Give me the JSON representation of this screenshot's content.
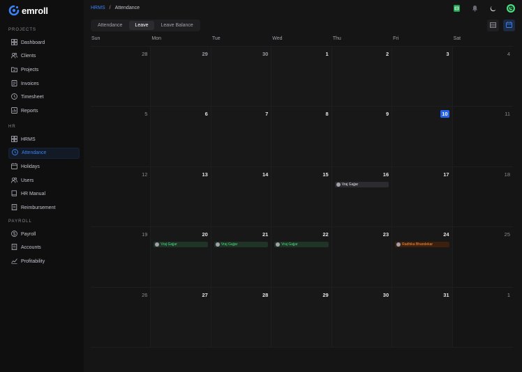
{
  "app": {
    "name": "emroll"
  },
  "colors": {
    "accent": "#3b82f6",
    "today": "#2563eb"
  },
  "sidebar": {
    "sections": [
      {
        "title": "PROJECTS",
        "items": [
          {
            "label": "Dashboard",
            "icon": "dashboard-icon"
          },
          {
            "label": "Clients",
            "icon": "users-icon"
          },
          {
            "label": "Projects",
            "icon": "folder-icon"
          },
          {
            "label": "Invoices",
            "icon": "invoice-icon"
          },
          {
            "label": "Timesheet",
            "icon": "clock-icon"
          },
          {
            "label": "Reports",
            "icon": "reports-icon"
          }
        ]
      },
      {
        "title": "HR",
        "items": [
          {
            "label": "HRMS",
            "icon": "dashboard-icon"
          },
          {
            "label": "Attendance",
            "icon": "clock-icon",
            "active": true
          },
          {
            "label": "Holidays",
            "icon": "calendar-icon"
          },
          {
            "label": "Users",
            "icon": "users-icon"
          },
          {
            "label": "HR Manual",
            "icon": "book-icon"
          },
          {
            "label": "Reimbursement",
            "icon": "receipt-icon"
          }
        ]
      },
      {
        "title": "PAYROLL",
        "items": [
          {
            "label": "Payroll",
            "icon": "coin-icon"
          },
          {
            "label": "Accounts",
            "icon": "receipt-icon"
          },
          {
            "label": "Profitability",
            "icon": "chart-icon"
          }
        ]
      }
    ]
  },
  "breadcrumb": {
    "parent": "HRMS",
    "separator": "/",
    "current": "Attendance"
  },
  "tabs": [
    {
      "label": "Attendance",
      "active": false
    },
    {
      "label": "Leave",
      "active": true
    },
    {
      "label": "Leave Balance",
      "active": false
    }
  ],
  "calendar": {
    "weekdays": [
      "Sun",
      "Mon",
      "Tue",
      "Wed",
      "Thu",
      "Fri",
      "Sat"
    ],
    "days": [
      {
        "n": "28",
        "muted": true
      },
      {
        "n": "29",
        "muted": true
      },
      {
        "n": "30",
        "muted": true
      },
      {
        "n": "1"
      },
      {
        "n": "2"
      },
      {
        "n": "3"
      },
      {
        "n": "4"
      },
      {
        "n": "5"
      },
      {
        "n": "6"
      },
      {
        "n": "7"
      },
      {
        "n": "8"
      },
      {
        "n": "9"
      },
      {
        "n": "10",
        "today": true
      },
      {
        "n": "11"
      },
      {
        "n": "12"
      },
      {
        "n": "13"
      },
      {
        "n": "14"
      },
      {
        "n": "15"
      },
      {
        "n": "16",
        "event": {
          "name": "Vraj Gajjar",
          "color": "grey"
        }
      },
      {
        "n": "17"
      },
      {
        "n": "18"
      },
      {
        "n": "19"
      },
      {
        "n": "20",
        "event": {
          "name": "Vraj Gajjar",
          "color": "green"
        }
      },
      {
        "n": "21",
        "event": {
          "name": "Vraj Gajjar",
          "color": "green"
        }
      },
      {
        "n": "22",
        "event": {
          "name": "Vraj Gajjar",
          "color": "green"
        }
      },
      {
        "n": "23"
      },
      {
        "n": "24",
        "event": {
          "name": "Radhika Bhandekar",
          "color": "orange"
        }
      },
      {
        "n": "25"
      },
      {
        "n": "26"
      },
      {
        "n": "27"
      },
      {
        "n": "28"
      },
      {
        "n": "29"
      },
      {
        "n": "30"
      },
      {
        "n": "31"
      },
      {
        "n": "1",
        "muted": true
      }
    ]
  }
}
